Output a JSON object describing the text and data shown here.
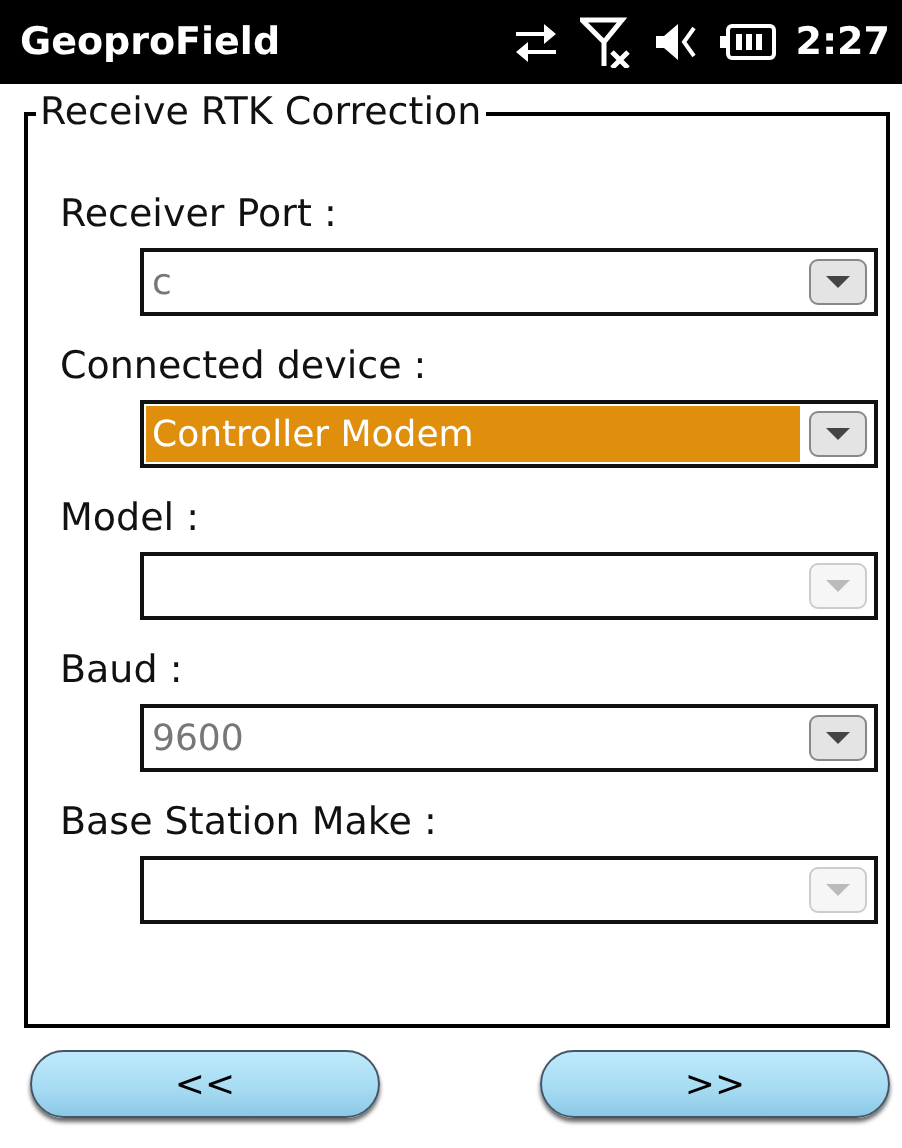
{
  "title_bar": {
    "title": "GeoproField",
    "time": "2:27"
  },
  "group": {
    "title": "Receive RTK Correction",
    "fields": [
      {
        "label": "Receiver Port :",
        "value": "c",
        "selected": false,
        "disabled": false
      },
      {
        "label": "Connected device :",
        "value": "Controller Modem",
        "selected": true,
        "disabled": false
      },
      {
        "label": "Model :",
        "selected": false,
        "disabled": true
      },
      {
        "label": "Baud :",
        "value": "9600",
        "selected": false,
        "disabled": false
      },
      {
        "label": "Base Station Make :",
        "selected": false,
        "disabled": true
      }
    ]
  },
  "buttons": [
    {
      "label": "<<"
    },
    {
      "label": ">>"
    }
  ]
}
